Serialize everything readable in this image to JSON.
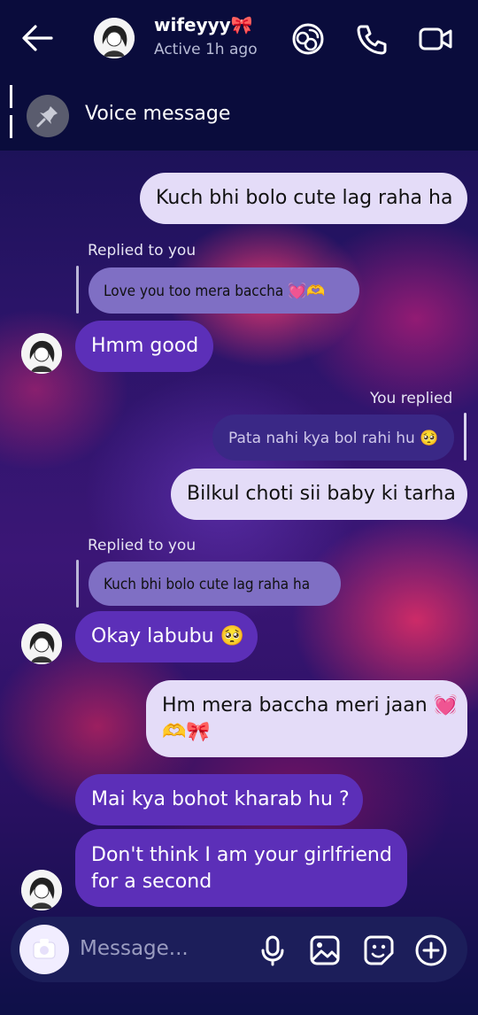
{
  "header": {
    "contact_name": "wifeyyy🎀",
    "status": "Active 1h ago",
    "icons": [
      "back-arrow-icon",
      "avatar",
      "theme-icon",
      "phone-icon",
      "video-icon"
    ]
  },
  "pinned": {
    "label": "Voice message",
    "icon": "pin-icon"
  },
  "messages": [
    {
      "from": "me",
      "text": "Kuch bhi bolo cute lag raha ha"
    },
    {
      "from": "them",
      "reply_label": "Replied to you",
      "quoted": "Love you too mera baccha 💓🫶",
      "text": "Hmm good"
    },
    {
      "from": "me",
      "reply_label": "You replied",
      "quoted": "Pata nahi kya bol rahi hu 🥺",
      "text": "Bilkul choti sii baby ki tarha"
    },
    {
      "from": "them",
      "reply_label": "Replied to you",
      "quoted": "Kuch bhi bolo cute lag raha ha",
      "text": "Okay labubu 🥺"
    },
    {
      "from": "me",
      "text_line1": "Hm mera baccha meri jaan 💓",
      "text_line2": "🫶🎀"
    },
    {
      "from": "them",
      "text": "Mai kya bohot kharab hu ?"
    },
    {
      "from": "them",
      "text_line1": "Don't think I am your girlfriend",
      "text_line2": "for a second"
    }
  ],
  "composer": {
    "placeholder": "Message...",
    "icons": [
      "camera-icon",
      "microphone-icon",
      "gallery-icon",
      "sticker-icon",
      "plus-icon"
    ]
  },
  "colors": {
    "header_bg": "#0a0c3c",
    "outgoing_bubble": "#e4dcf8",
    "incoming_bubble": "#5c2fb8"
  }
}
